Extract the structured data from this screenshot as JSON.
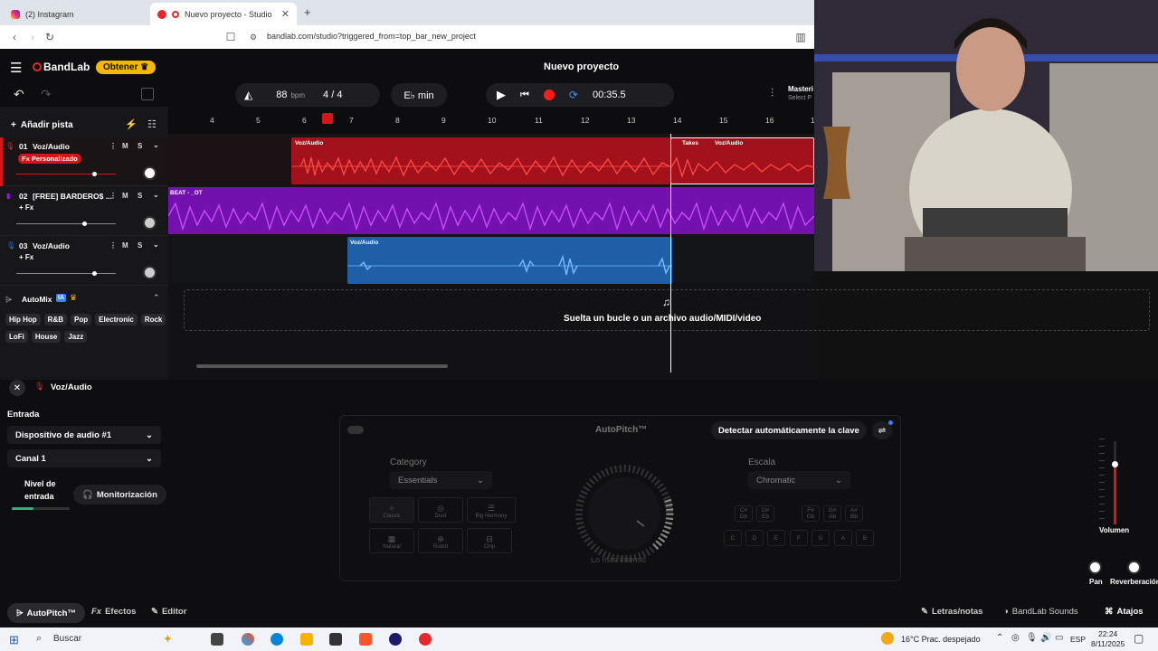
{
  "browser": {
    "tabs": [
      {
        "label": "(2) Instagram"
      },
      {
        "label": "Nuevo proyecto - Studio"
      }
    ],
    "url": "bandlab.com/studio?triggered_from=top_bar_new_project"
  },
  "app": {
    "brand": "BandLab",
    "get_button": "Obtener",
    "project_title": "Nuevo proyecto",
    "tempo": "88",
    "tempo_unit": "bpm",
    "time_sig": "4 / 4",
    "key": "E♭ min",
    "time": "00:35.5",
    "mastering_label": "Masteri",
    "mastering_sub": "Select P",
    "add_track": "Añadir pista"
  },
  "ruler": [
    "4",
    "5",
    "6",
    "7",
    "8",
    "9",
    "10",
    "11",
    "12",
    "13",
    "14",
    "15",
    "16",
    "1"
  ],
  "tracks": [
    {
      "num": "01",
      "name": "Voz/Audio",
      "fx": "Fx Personalizado",
      "clip": "Voz/Audio",
      "takes": "Takes",
      "clip2": "Voz/Audio",
      "color": "#d4151c"
    },
    {
      "num": "02",
      "name": "[FREE] BARDERO$ ...",
      "fx": "+ Fx",
      "clip": "BEAT - _OT",
      "color": "#9b17e0"
    },
    {
      "num": "03",
      "name": "Voz/Audio",
      "fx": "+ Fx",
      "clip": "Voz/Audio",
      "color": "#2a74c8"
    }
  ],
  "mute_label": "M",
  "solo_label": "S",
  "automix": {
    "title": "AutoMix",
    "badge": "IA",
    "genres_row1": [
      "Hip Hop",
      "R&B",
      "Pop",
      "Electronic",
      "Rock"
    ],
    "genres_row2": [
      "LoFi",
      "House",
      "Jazz"
    ]
  },
  "drop_text": "Suelta un bucle o un archivo audio/MIDI/video",
  "panel": {
    "track_name": "Voz/Audio",
    "input_label": "Entrada",
    "device": "Dispositivo de audio #1",
    "channel": "Canal 1",
    "level_label_1": "Nivel de",
    "level_label_2": "entrada",
    "monitor_button": "Monitorización"
  },
  "autopitch": {
    "title": "AutoPitch™",
    "detect_button": "Detectar automáticamente la clave",
    "category_label": "Category",
    "category_value": "Essentials",
    "scale_label": "Escala",
    "scale_value": "Chromatic",
    "presets": [
      "Classic",
      "Duet",
      "Big Harmony",
      "Natural",
      "Robot",
      "Chip"
    ],
    "dial_label": "Lo más intenso",
    "keys_top": [
      "C#\nDb",
      "D#\nEb",
      "F#\nGb",
      "G#\nAb",
      "A#\nBb"
    ],
    "keys_bottom": [
      "C",
      "D",
      "E",
      "F",
      "G",
      "A",
      "B"
    ]
  },
  "mixer": {
    "volume_label": "Volumen",
    "pan_label": "Pan",
    "reverb_label": "Reverberación"
  },
  "bottom": {
    "autopitch": "AutoPitch™",
    "effects": "Efectos",
    "editor": "Editor",
    "lyrics": "Letras/notas",
    "sounds": "BandLab Sounds",
    "shortcuts": "Atajos"
  },
  "taskbar": {
    "search": "Buscar",
    "weather": "16°C  Prac. despejado",
    "lang": "ESP",
    "time": "22:24",
    "date": "8/11/2025"
  }
}
